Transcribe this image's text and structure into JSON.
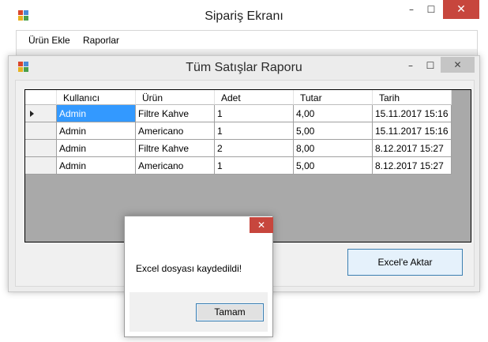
{
  "main_window": {
    "title": "Sipariş Ekranı",
    "controls": {
      "minimize": "–",
      "maximize": "☐",
      "close": "✕"
    },
    "menu": [
      "Ürün Ekle",
      "Raporlar"
    ]
  },
  "report_window": {
    "title": "Tüm Satışlar Raporu",
    "controls": {
      "minimize": "–",
      "maximize": "☐",
      "close": "✕"
    },
    "grid": {
      "columns": [
        "Kullanıcı",
        "Ürün",
        "Adet",
        "Tutar",
        "Tarih"
      ],
      "rows": [
        [
          "Admin",
          "Filtre Kahve",
          "1",
          "4,00",
          "15.11.2017 15:16"
        ],
        [
          "Admin",
          "Americano",
          "1",
          "5,00",
          "15.11.2017 15:16"
        ],
        [
          "Admin",
          "Filtre Kahve",
          "2",
          "8,00",
          "8.12.2017 15:27"
        ],
        [
          "Admin",
          "Americano",
          "1",
          "5,00",
          "8.12.2017 15:27"
        ]
      ],
      "current_row": 1
    },
    "export_button": "Excel'e Aktar"
  },
  "message_box": {
    "text": "Excel dosyası kaydedildi!",
    "ok_button": "Tamam",
    "close": "✕"
  },
  "colors": {
    "selection": "#3399ff",
    "close_red": "#c7463d",
    "grid_bg": "#a9a9a9"
  },
  "icons": [
    "app-icon",
    "close-icon",
    "minimize-icon",
    "maximize-icon",
    "row-pointer-icon"
  ]
}
